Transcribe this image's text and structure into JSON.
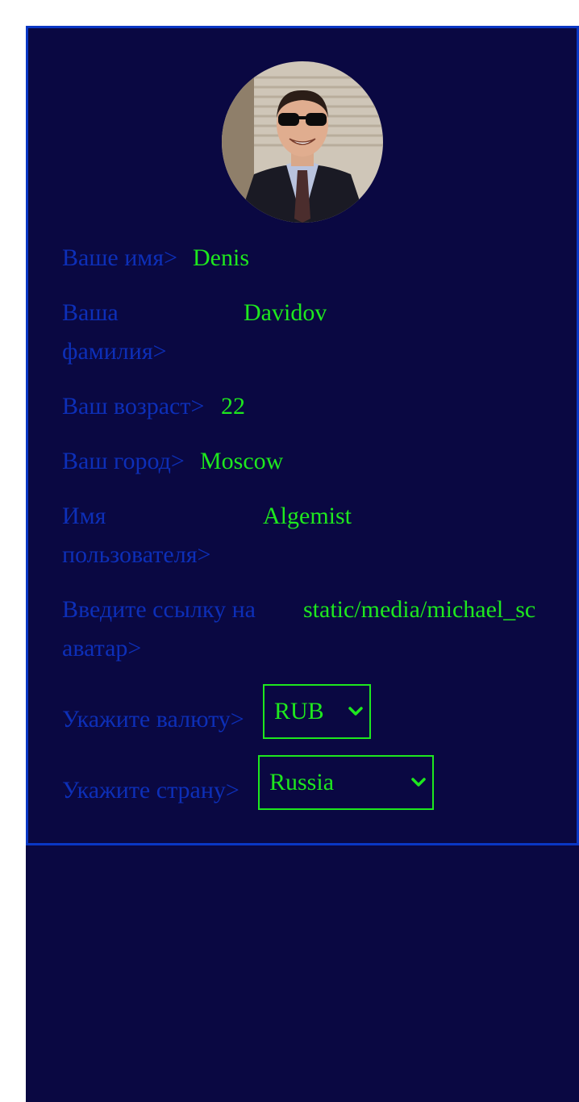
{
  "profile": {
    "fields": [
      {
        "label": "Ваше имя>",
        "value": "Denis"
      },
      {
        "label": "Ваша фамилия>",
        "value": "Davidov"
      },
      {
        "label": "Ваш возраст>",
        "value": "22"
      },
      {
        "label": "Ваш город>",
        "value": "Moscow"
      },
      {
        "label": "Имя пользователя>",
        "value": "Algemist"
      },
      {
        "label": "Введите ссылку на аватар>",
        "value": "static/media/michael_sc"
      }
    ],
    "currency": {
      "label": "Укажите валюту>",
      "value": "RUB"
    },
    "country": {
      "label": "Укажите страну>",
      "value": "Russia"
    }
  },
  "colors": {
    "background": "#0a0842",
    "border": "#0a37c4",
    "label": "#0d2fb8",
    "value": "#1ee81e"
  },
  "icons": {
    "select_arrow": "chevron-down-icon"
  }
}
